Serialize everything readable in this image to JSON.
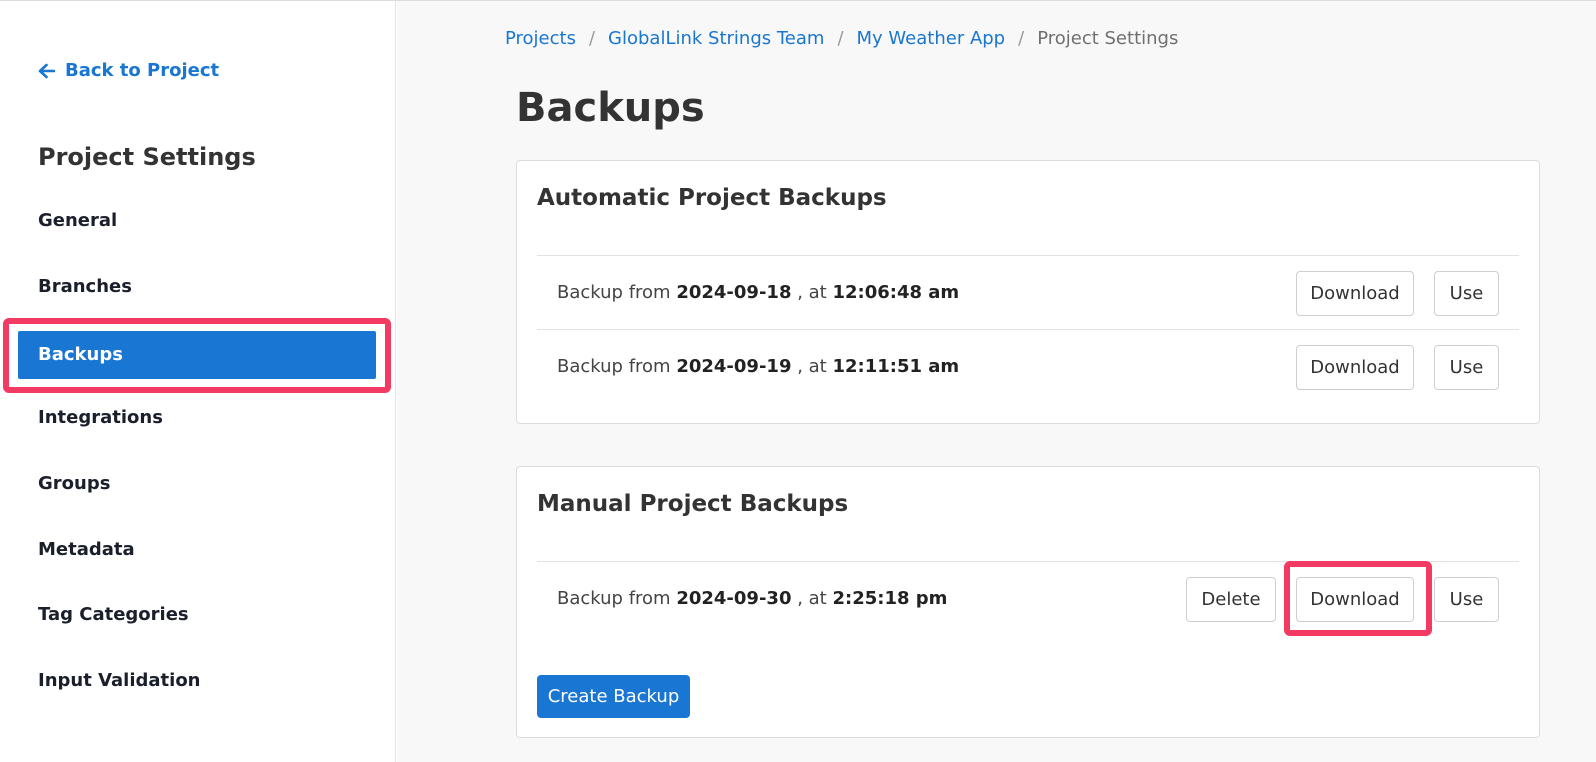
{
  "sidebar": {
    "back_label": "Back to Project",
    "title": "Project Settings",
    "items": [
      {
        "label": "General"
      },
      {
        "label": "Branches"
      },
      {
        "label": "Backups",
        "active": true
      },
      {
        "label": "Integrations"
      },
      {
        "label": "Groups"
      },
      {
        "label": "Metadata"
      },
      {
        "label": "Tag Categories"
      },
      {
        "label": "Input Validation"
      }
    ]
  },
  "breadcrumb": {
    "items": [
      "Projects",
      "GlobalLink Strings Team",
      "My Weather App"
    ],
    "current": "Project Settings",
    "separator": "/"
  },
  "page": {
    "title": "Backups"
  },
  "automatic": {
    "title": "Automatic Project Backups",
    "rows": [
      {
        "prefix": "Backup from",
        "date": "2024-09-18",
        "mid": ", at",
        "time": "12:06:48 am"
      },
      {
        "prefix": "Backup from",
        "date": "2024-09-19",
        "mid": ", at",
        "time": "12:11:51 am"
      }
    ]
  },
  "manual": {
    "title": "Manual Project Backups",
    "rows": [
      {
        "prefix": "Backup from",
        "date": "2024-09-30",
        "mid": ", at",
        "time": "2:25:18 pm"
      }
    ],
    "create_label": "Create Backup"
  },
  "buttons": {
    "download": "Download",
    "use": "Use",
    "delete": "Delete"
  },
  "colors": {
    "accent": "#1976d2",
    "highlight": "#f23a62"
  }
}
